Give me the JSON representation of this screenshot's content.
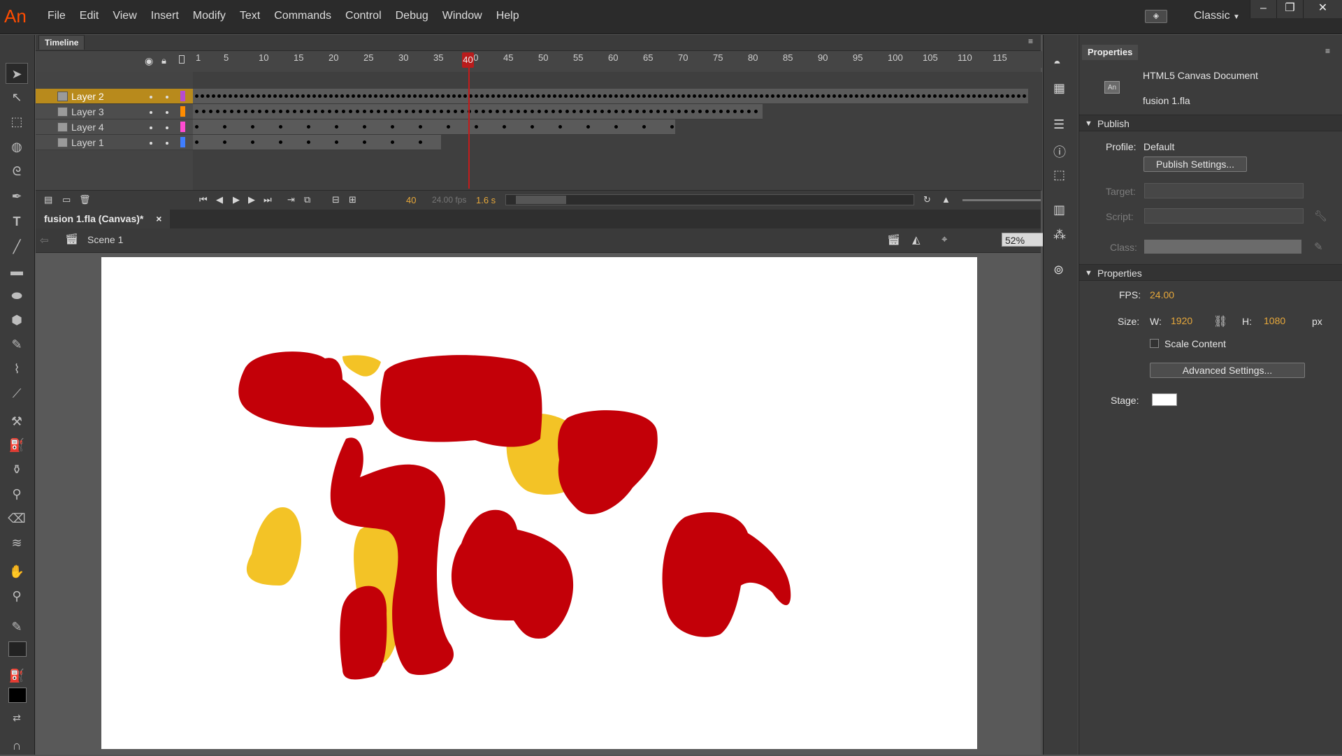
{
  "app": {
    "logo": "An"
  },
  "menu": [
    "File",
    "Edit",
    "View",
    "Insert",
    "Modify",
    "Text",
    "Commands",
    "Control",
    "Debug",
    "Window",
    "Help"
  ],
  "workspace": {
    "label": "Classic"
  },
  "window_controls": {
    "minimize": "–",
    "restore": "❐",
    "close": "✕"
  },
  "timeline": {
    "tab_label": "Timeline",
    "ruler_ticks": [
      "1",
      "5",
      "10",
      "15",
      "20",
      "25",
      "30",
      "35",
      "40",
      "45",
      "50",
      "55",
      "60",
      "65",
      "70",
      "75",
      "80",
      "85",
      "90",
      "95",
      "100",
      "105",
      "110",
      "115"
    ],
    "layers": [
      {
        "name": "Layer 2",
        "selected": true,
        "color": "#b64ccf"
      },
      {
        "name": "Layer 3",
        "selected": false,
        "color": "#ff8c00"
      },
      {
        "name": "Layer 4",
        "selected": false,
        "color": "#ff4cd2"
      },
      {
        "name": "Layer 1",
        "selected": false,
        "color": "#3f7eff"
      }
    ],
    "playhead_frame": "40",
    "current_frame": "40",
    "fps_readout": "24.00 fps",
    "time_readout": "1.6 s"
  },
  "document": {
    "tab_label": "fusion 1.fla (Canvas)*",
    "close": "×",
    "scene": "Scene 1",
    "zoom": "52%"
  },
  "properties": {
    "tab_label": "Properties",
    "doc_type": "HTML5 Canvas Document",
    "file_name": "fusion 1.fla",
    "doc_icon": "An",
    "publish": {
      "header": "Publish",
      "profile_label": "Profile:",
      "profile_value": "Default",
      "publish_settings_button": "Publish Settings...",
      "target_label": "Target:",
      "script_label": "Script:",
      "class_label": "Class:"
    },
    "props": {
      "header": "Properties",
      "fps_label": "FPS:",
      "fps_value": "24.00",
      "size_label": "Size:",
      "w_label": "W:",
      "w_value": "1920",
      "h_label": "H:",
      "h_value": "1080",
      "unit": "px",
      "scale_content": "Scale Content",
      "advanced_button": "Advanced Settings...",
      "stage_label": "Stage:",
      "stage_color": "#ffffff"
    }
  },
  "colors": {
    "red": "#c30008",
    "yellow": "#f3c326"
  }
}
